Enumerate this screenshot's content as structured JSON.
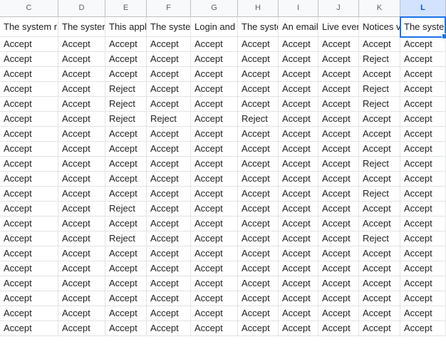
{
  "sheet": {
    "columns": [
      "C",
      "D",
      "E",
      "F",
      "G",
      "H",
      "I",
      "J",
      "K",
      "L"
    ],
    "selected_column": "L",
    "header_row": [
      "The system r",
      "The syster",
      "This appl",
      "The syste",
      "Login and",
      "The syste",
      "An email",
      "Live ever",
      "Notices v",
      "The syster"
    ],
    "rows": [
      [
        "Accept",
        "Accept",
        "Accept",
        "Accept",
        "Accept",
        "Accept",
        "Accept",
        "Accept",
        "Accept",
        "Accept"
      ],
      [
        "Accept",
        "Accept",
        "Accept",
        "Accept",
        "Accept",
        "Accept",
        "Accept",
        "Accept",
        "Reject",
        "Accept"
      ],
      [
        "Accept",
        "Accept",
        "Accept",
        "Accept",
        "Accept",
        "Accept",
        "Accept",
        "Accept",
        "Accept",
        "Accept"
      ],
      [
        "Accept",
        "Accept",
        "Reject",
        "Accept",
        "Accept",
        "Accept",
        "Accept",
        "Accept",
        "Reject",
        "Accept"
      ],
      [
        "Accept",
        "Accept",
        "Reject",
        "Accept",
        "Accept",
        "Accept",
        "Accept",
        "Accept",
        "Reject",
        "Accept"
      ],
      [
        "Accept",
        "Accept",
        "Reject",
        "Reject",
        "Accept",
        "Reject",
        "Accept",
        "Accept",
        "Accept",
        "Accept"
      ],
      [
        "Accept",
        "Accept",
        "Accept",
        "Accept",
        "Accept",
        "Accept",
        "Accept",
        "Accept",
        "Accept",
        "Accept"
      ],
      [
        "Accept",
        "Accept",
        "Accept",
        "Accept",
        "Accept",
        "Accept",
        "Accept",
        "Accept",
        "Accept",
        "Accept"
      ],
      [
        "Accept",
        "Accept",
        "Accept",
        "Accept",
        "Accept",
        "Accept",
        "Accept",
        "Accept",
        "Reject",
        "Accept"
      ],
      [
        "Accept",
        "Accept",
        "Accept",
        "Accept",
        "Accept",
        "Accept",
        "Accept",
        "Accept",
        "Accept",
        "Accept"
      ],
      [
        "Accept",
        "Accept",
        "Accept",
        "Accept",
        "Accept",
        "Accept",
        "Accept",
        "Accept",
        "Reject",
        "Accept"
      ],
      [
        "Accept",
        "Accept",
        "Reject",
        "Accept",
        "Accept",
        "Accept",
        "Accept",
        "Accept",
        "Accept",
        "Accept"
      ],
      [
        "Accept",
        "Accept",
        "Accept",
        "Accept",
        "Accept",
        "Accept",
        "Accept",
        "Accept",
        "Accept",
        "Accept"
      ],
      [
        "Accept",
        "Accept",
        "Reject",
        "Accept",
        "Accept",
        "Accept",
        "Accept",
        "Accept",
        "Reject",
        "Accept"
      ],
      [
        "Accept",
        "Accept",
        "Accept",
        "Accept",
        "Accept",
        "Accept",
        "Accept",
        "Accept",
        "Accept",
        "Accept"
      ],
      [
        "Accept",
        "Accept",
        "Accept",
        "Accept",
        "Accept",
        "Accept",
        "Accept",
        "Accept",
        "Accept",
        "Accept"
      ],
      [
        "Accept",
        "Accept",
        "Accept",
        "Accept",
        "Accept",
        "Accept",
        "Accept",
        "Accept",
        "Accept",
        "Accept"
      ],
      [
        "Accept",
        "Accept",
        "Accept",
        "Accept",
        "Accept",
        "Accept",
        "Accept",
        "Accept",
        "Accept",
        "Accept"
      ],
      [
        "Accept",
        "Accept",
        "Accept",
        "Accept",
        "Accept",
        "Accept",
        "Accept",
        "Accept",
        "Accept",
        "Accept"
      ],
      [
        "Accept",
        "Accept",
        "Accept",
        "Accept",
        "Accept",
        "Accept",
        "Accept",
        "Accept",
        "Accept",
        "Accept"
      ]
    ]
  }
}
